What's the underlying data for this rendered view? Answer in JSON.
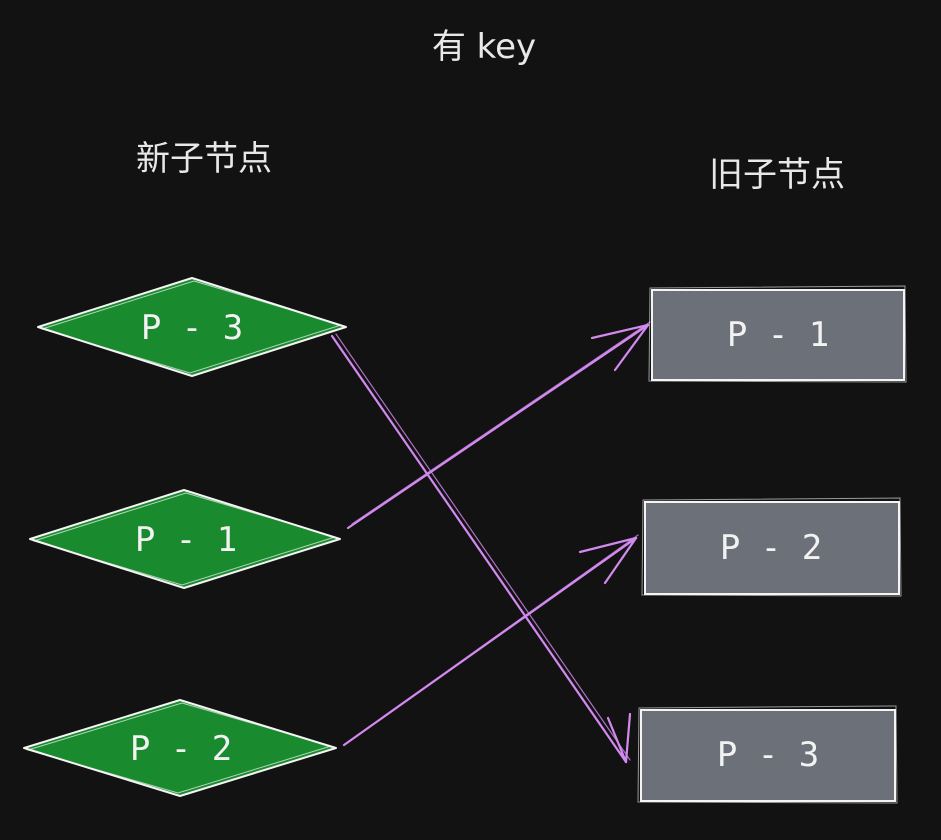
{
  "title": "有 key",
  "new_label": "新子节点",
  "old_label": "旧子节点",
  "new_nodes": [
    {
      "label": "P - 3"
    },
    {
      "label": "P - 1"
    },
    {
      "label": "P - 2"
    }
  ],
  "old_nodes": [
    {
      "label": "P - 1"
    },
    {
      "label": "P - 2"
    },
    {
      "label": "P - 3"
    }
  ],
  "colors": {
    "background": "#121212",
    "diamond_fill": "#198a2e",
    "rect_fill": "#6b7079",
    "stroke": "#f4f4f4",
    "arrow": "#d38af0"
  }
}
